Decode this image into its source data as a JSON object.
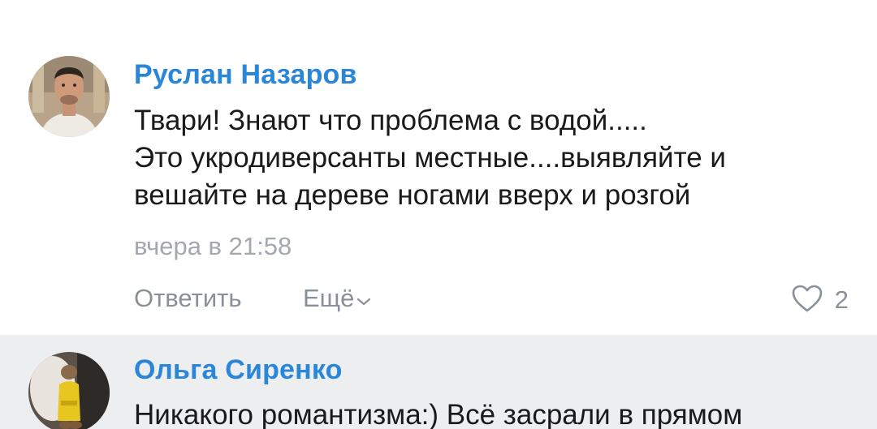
{
  "comments": [
    {
      "author": "Руслан Назаров",
      "text_lines": [
        "Твари! Знают что проблема с водой.....",
        "Это укродиверсанты местные....выявляйте и",
        "вешайте на дереве ногами вверх и розгой"
      ],
      "timestamp": "вчера в 21:58",
      "reply_label": "Ответить",
      "more_label": "Ещё",
      "likes": "2"
    },
    {
      "author": "Ольга Сиренко",
      "text_lines": [
        "Никакого романтизма:) Всё засрали в прямом"
      ]
    }
  ],
  "colors": {
    "author_link": "#2a86d8",
    "secondary_text": "#8a9099",
    "highlight_bg": "#edeef0"
  }
}
